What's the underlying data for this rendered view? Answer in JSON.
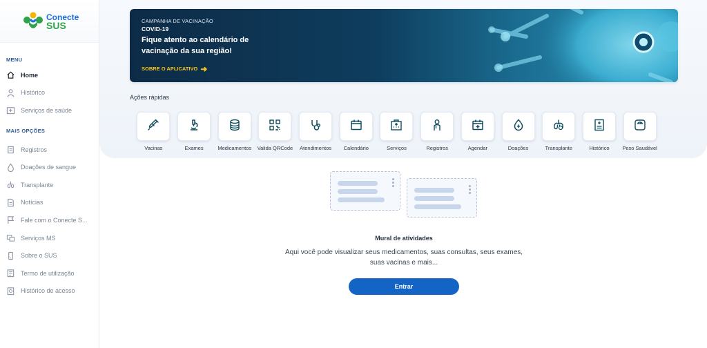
{
  "brand": {
    "line1": "Conecte",
    "line2": "SUS"
  },
  "sidebar": {
    "menu_label": "MENU",
    "menu_items": [
      {
        "label": "Home",
        "icon": "home-icon",
        "active": true
      },
      {
        "label": "Histórico",
        "icon": "person-icon"
      },
      {
        "label": "Serviços de saúde",
        "icon": "clinic-icon"
      }
    ],
    "more_label": "MAIS OPÇÕES",
    "more_items": [
      {
        "label": "Registros",
        "icon": "clipboard-icon"
      },
      {
        "label": "Doações de sangue",
        "icon": "blood-drop-icon"
      },
      {
        "label": "Transplante",
        "icon": "lungs-icon"
      },
      {
        "label": "Notícias",
        "icon": "document-icon"
      },
      {
        "label": "Fale com o Conecte S...",
        "icon": "flag-icon"
      },
      {
        "label": "Serviços MS",
        "icon": "services-icon"
      },
      {
        "label": "Sobre o SUS",
        "icon": "phone-icon"
      },
      {
        "label": "Termo de utilização",
        "icon": "terms-icon"
      },
      {
        "label": "Histórico de acesso",
        "icon": "history-icon"
      }
    ]
  },
  "banner": {
    "kicker": "CAMPANHA DE VACINAÇÃO",
    "tag": "COVID-19",
    "title": "Fique atento ao calendário de vacinação da sua região!",
    "link": "SOBRE O APLICATIVO"
  },
  "quick_actions": {
    "title": "Ações rápidas",
    "items": [
      {
        "label": "Vacinas",
        "icon": "syringe-icon"
      },
      {
        "label": "Exames",
        "icon": "microscope-icon"
      },
      {
        "label": "Medicamentos",
        "icon": "pills-icon"
      },
      {
        "label": "Valida QRCode",
        "icon": "qrcode-icon"
      },
      {
        "label": "Atendimentos",
        "icon": "stethoscope-icon"
      },
      {
        "label": "Calendário",
        "icon": "calendar-icon"
      },
      {
        "label": "Serviços",
        "icon": "hospital-icon"
      },
      {
        "label": "Registros",
        "icon": "nurse-icon"
      },
      {
        "label": "Agendar",
        "icon": "calendar-plus-icon"
      },
      {
        "label": "Doações",
        "icon": "drop-plus-icon"
      },
      {
        "label": "Transplante",
        "icon": "lungs-icon"
      },
      {
        "label": "Histórico",
        "icon": "record-icon"
      },
      {
        "label": "Peso Saudável",
        "icon": "scale-icon"
      }
    ]
  },
  "mural": {
    "title": "Mural de atividades",
    "description": "Aqui você pode visualizar seus medicamentos, suas consultas, seus exames, suas vacinas e mais...",
    "button": "Entrar"
  },
  "colors": {
    "primary": "#1464c6",
    "accent": "#f5c518",
    "icon_teal": "#0f4c5c"
  }
}
